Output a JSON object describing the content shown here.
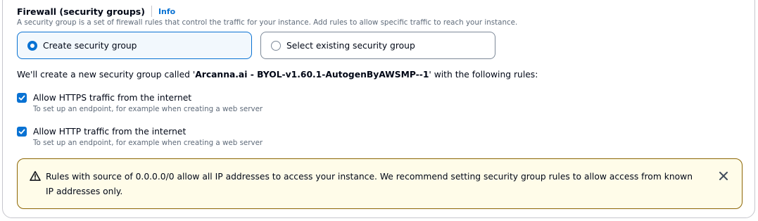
{
  "section": {
    "title": "Firewall (security groups)",
    "info_link": "Info",
    "description": "A security group is a set of firewall rules that control the traffic for your instance. Add rules to allow specific traffic to reach your instance."
  },
  "options": {
    "create": {
      "label": "Create security group",
      "selected": true
    },
    "existing": {
      "label": "Select existing security group",
      "selected": false
    }
  },
  "sg_message": {
    "prefix": "We'll create a new security group called '",
    "name": "Arcanna.ai - BYOL-v1.60.1-AutogenByAWSMP--1",
    "suffix": "' with the following rules:"
  },
  "rules": [
    {
      "label": "Allow HTTPS traffic from the internet",
      "description": "To set up an endpoint, for example when creating a web server",
      "checked": true
    },
    {
      "label": "Allow HTTP traffic from the internet",
      "description": "To set up an endpoint, for example when creating a web server",
      "checked": true
    }
  ],
  "warning": {
    "icon": "warning-icon",
    "text": "Rules with source of 0.0.0.0/0 allow all IP addresses to access your instance. We recommend setting security group rules to allow access from known IP addresses only.",
    "close_icon": "close-icon"
  },
  "colors": {
    "accent": "#0972d3",
    "warning_border": "#8d6605",
    "warning_bg": "#fffce9",
    "muted_text": "#5f6b7a"
  }
}
